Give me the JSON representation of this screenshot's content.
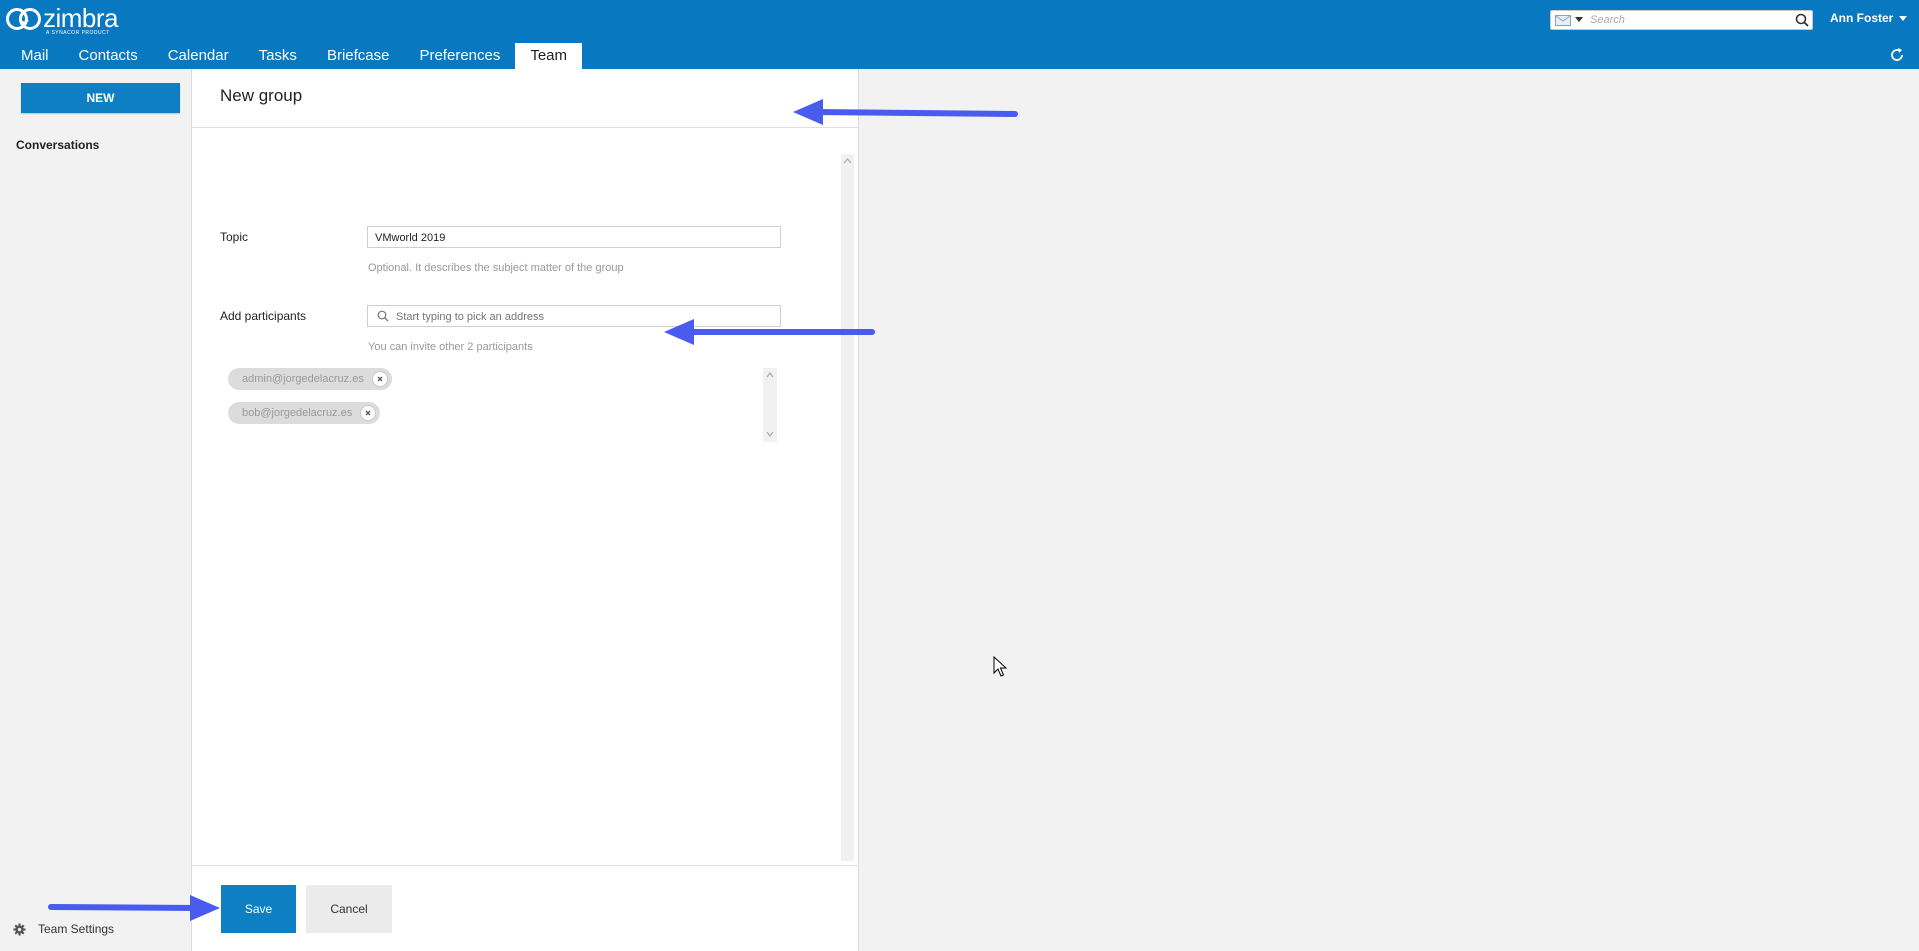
{
  "app": {
    "logo_text": "zimbra",
    "logo_subtext": "A SYNACOR PRODUCT",
    "user_name": "Ann Foster"
  },
  "search": {
    "placeholder": "Search"
  },
  "nav": {
    "tabs": [
      {
        "label": "Mail"
      },
      {
        "label": "Contacts"
      },
      {
        "label": "Calendar"
      },
      {
        "label": "Tasks"
      },
      {
        "label": "Briefcase"
      },
      {
        "label": "Preferences"
      },
      {
        "label": "Team",
        "active": true
      }
    ]
  },
  "sidebar": {
    "new_label": "NEW",
    "conversations_label": "Conversations",
    "settings_label": "Team Settings"
  },
  "form": {
    "title": "New group",
    "topic_label": "Topic",
    "topic_value": "VMworld 2019",
    "topic_hint": "Optional. It describes the subject matter of the group",
    "participants_label": "Add participants",
    "participants_placeholder": "Start typing to pick an address",
    "participants_hint": "You can invite other 2 participants",
    "participants": [
      "admin@jorgedelacruz.es",
      "bob@jorgedelacruz.es"
    ],
    "save_label": "Save",
    "cancel_label": "Cancel"
  },
  "colors": {
    "topbar": "#0879c0",
    "primary_button": "#0d7fc2",
    "annotation_arrow": "#4a5bef"
  }
}
